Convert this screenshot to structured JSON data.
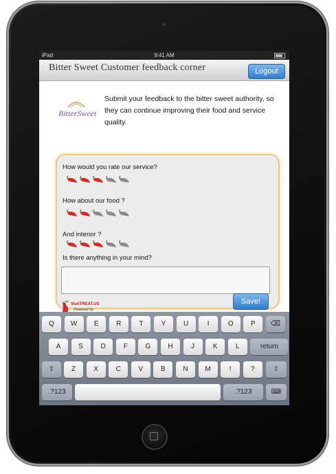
{
  "status_bar": {
    "carrier": "iPad",
    "time": "9:41 AM"
  },
  "nav": {
    "title": "Bitter Sweet Customer feedback corner",
    "logout_label": "Logout"
  },
  "logo": {
    "text": "BitterSweet"
  },
  "intro_text": "Submit your feedback to the bitter sweet authority, so they can continue improving their food and service quality.",
  "questions": [
    {
      "label": "How would you rate our service?",
      "rating": 3,
      "max": 5
    },
    {
      "label": "How about our food ?",
      "rating": 2,
      "max": 5
    },
    {
      "label": "And interior ?",
      "rating": 3,
      "max": 5
    }
  ],
  "comment": {
    "label": "Is there anything in your mind?",
    "value": ""
  },
  "save_label": "Save!",
  "powered": {
    "brand": "VisitTREAT.US",
    "caption": "Powered by"
  },
  "keyboard": {
    "row1": [
      "Q",
      "W",
      "E",
      "R",
      "T",
      "Y",
      "U",
      "I",
      "O",
      "P",
      "⌫"
    ],
    "row2": [
      "A",
      "S",
      "D",
      "F",
      "G",
      "H",
      "J",
      "K",
      "L",
      "return"
    ],
    "row3": [
      "⇧",
      "Z",
      "X",
      "C",
      "V",
      "B",
      "N",
      "M",
      "!",
      "?",
      "⇧"
    ],
    "row4": [
      ".?123",
      "",
      ".?123",
      "⌨"
    ]
  },
  "colors": {
    "accent": "#2f7ecb",
    "chili_active": "#d42a2a",
    "chili_inactive": "#8a8a8a",
    "panel_glow": "#e8c990"
  }
}
